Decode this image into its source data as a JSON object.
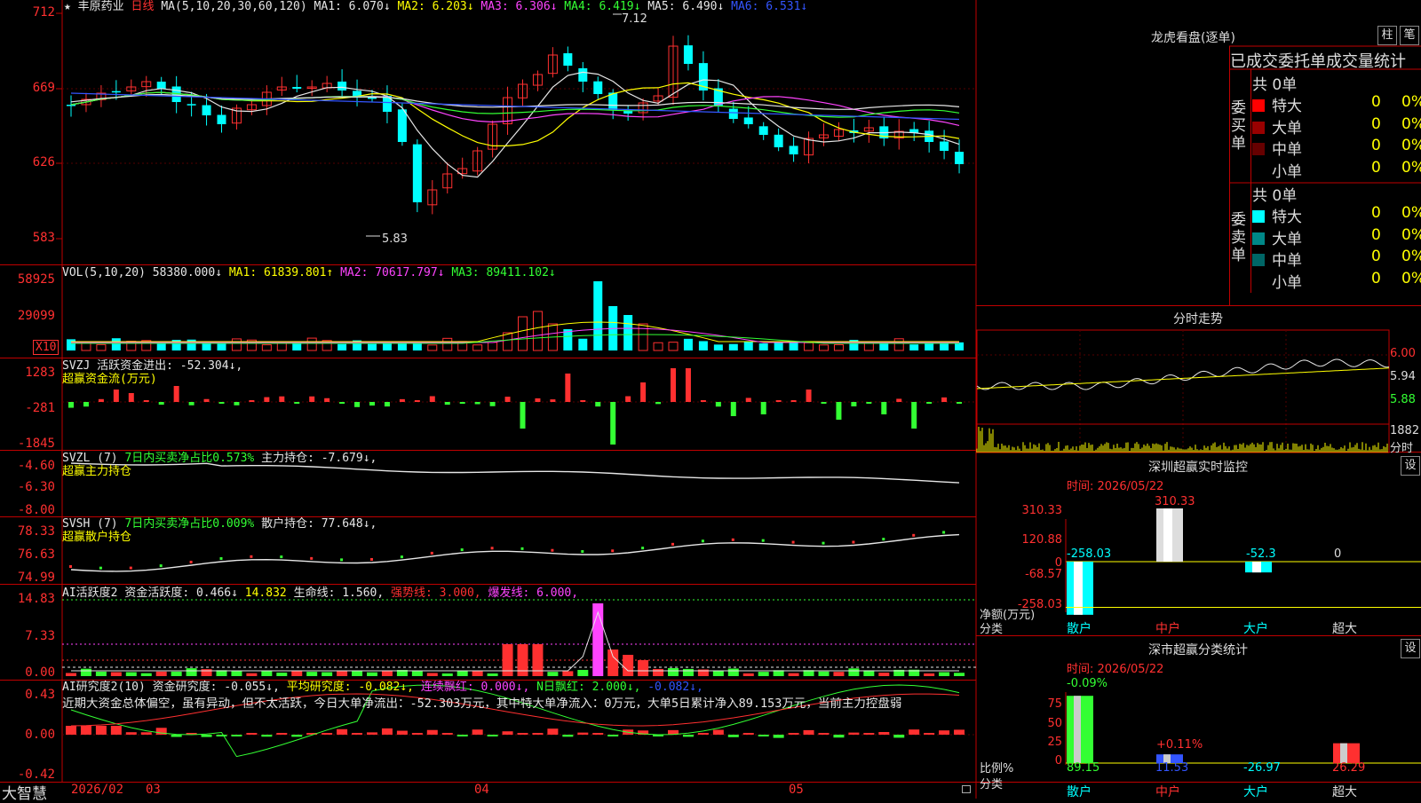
{
  "stock": {
    "star": "★",
    "name": "丰原药业",
    "period": "日线",
    "ma_label": "MA(5,10,20,30,60,120)",
    "ma": [
      {
        "label": "MA1:",
        "value": "6.070↓",
        "color": "#e6e6e6"
      },
      {
        "label": "MA2:",
        "value": "6.203↓",
        "color": "#ffff00"
      },
      {
        "label": "MA3:",
        "value": "6.306↓",
        "color": "#ff44ff"
      },
      {
        "label": "MA4:",
        "value": "6.419↓",
        "color": "#33ff33"
      },
      {
        "label": "MA5:",
        "value": "6.490↓",
        "color": "#e6e6e6"
      },
      {
        "label": "MA6:",
        "value": "6.531↓",
        "color": "#3355ff"
      }
    ],
    "high_mark": "7.12",
    "low_mark": "5.83"
  },
  "price_axis": [
    "712",
    "669",
    "626",
    "583"
  ],
  "vol": {
    "title": "VOL(5,10,20)",
    "value": "58380.000↓",
    "ma1": "MA1: 61839.801↑",
    "ma2": "MA2: 70617.797↓",
    "ma3": "MA3: 89411.102↓",
    "axis": [
      "58925",
      "29099"
    ],
    "unit": "X10"
  },
  "svzj": {
    "title": "SVZJ  活跃资金进出: -52.304↓,",
    "subtitle": "超赢资金流(万元)",
    "axis": [
      "1283",
      "-281",
      "-1845"
    ]
  },
  "svzl": {
    "title": "SVZL (7)",
    "ratio": "7日内买卖净占比0.573%",
    "hold": "主力持仓: -7.679↓,",
    "subtitle": "超赢主力持仓",
    "axis": [
      "-4.60",
      "-6.30",
      "-8.00"
    ]
  },
  "svsh": {
    "title": "SVSH (7)",
    "ratio": "7日内买卖净占比0.009%",
    "hold": "散户持仓: 77.648↓,",
    "subtitle": "超赢散户持仓",
    "axis": [
      "78.33",
      "76.63",
      "74.99"
    ]
  },
  "ai2": {
    "title": "AI活跃度2",
    "active": "资金活跃度: 0.466↓",
    "v2": "14.832",
    "life": "生命线: 1.560,",
    "strong": "强势线: 3.000,",
    "burst": "爆发线: 6.000,",
    "axis": [
      "14.83",
      "7.33",
      "0.00"
    ]
  },
  "ai_research": {
    "title": "AI研究度2(10)",
    "research": "资金研究度: -0.055↓,",
    "avg": "平均研究度: -0.082↓,",
    "red": "连续飘红: 0.000↓,",
    "n_red": "N日飘红: 2.000↓,",
    "v5": "-0.082↓,",
    "comment": "近期大资金总体偏空，虽有异动，但不太活跃，今日大单净流出：-52.303万元，其中特大单净流入：0万元，大单5日累计净入89.153万元，当前主力控盘弱",
    "axis": [
      "0.43",
      "0.00",
      "-0.42"
    ]
  },
  "footer": {
    "brand": "大智慧",
    "dates": [
      "2026/02",
      "03",
      "04",
      "05"
    ]
  },
  "right": {
    "lhb_title": "龙虎看盘(逐单)",
    "btn_zhu": "柱",
    "btn_bi": "笔",
    "tabs_label": "已成交委托单成交量统计",
    "buy": {
      "side": "委买单",
      "total": "共 0单",
      "rows": [
        {
          "name": "特大",
          "count": "0",
          "pct": "0%",
          "color": "#ff0000"
        },
        {
          "name": "大单",
          "count": "0",
          "pct": "0%",
          "color": "#990000"
        },
        {
          "name": "中单",
          "count": "0",
          "pct": "0%",
          "color": "#660000"
        },
        {
          "name": "小单",
          "count": "0",
          "pct": "0%",
          "color": "#000000"
        }
      ]
    },
    "sell": {
      "side": "委卖单",
      "total": "共 0单",
      "rows": [
        {
          "name": "特大",
          "count": "0",
          "pct": "0%",
          "color": "#00ffff"
        },
        {
          "name": "大单",
          "count": "0",
          "pct": "0%",
          "color": "#008888"
        },
        {
          "name": "中单",
          "count": "0",
          "pct": "0%",
          "color": "#006666"
        },
        {
          "name": "小单",
          "count": "0",
          "pct": "0%",
          "color": "#000000"
        }
      ]
    },
    "minute_title": "分时走势",
    "minute_axis": [
      "6.00",
      "5.94",
      "5.88"
    ],
    "minute_vol": "1882",
    "minute_vol_unit": "分时",
    "sz_title": "深圳超赢实时监控",
    "sz_btn": "设",
    "sz_time": "时间: 2026/05/22",
    "sz_axis": [
      "310.33",
      "120.88",
      "0",
      "-68.57",
      "-258.03"
    ],
    "sz_labels": [
      "-258.03",
      "310.33",
      "-52.3",
      "0"
    ],
    "sz_cats": [
      "散户",
      "中户",
      "大户",
      "超大"
    ],
    "sz_unit": "净额(万元)",
    "sz_unit2": "分类",
    "sc_title": "深市超赢分类统计",
    "sc_btn": "设",
    "sc_time": "时间: 2026/05/22",
    "sc_axis": [
      "75",
      "50",
      "25",
      "0"
    ],
    "sc_top": [
      "-0.09%",
      "+0.11%"
    ],
    "sc_vals": [
      "89.15",
      "11.53",
      "-26.97",
      "26.29"
    ],
    "sc_cats": [
      "散户",
      "中户",
      "大户",
      "超大"
    ],
    "sc_unit": "比例%",
    "sc_unit2": "分类"
  },
  "chart_data": {
    "type": "bar",
    "categories": [
      "散户",
      "中户",
      "大户",
      "超大"
    ],
    "series": [
      {
        "values": [
          -258.03,
          310.33,
          -52.3,
          0
        ]
      },
      {
        "values": [
          89.15,
          11.53,
          -26.97,
          26.29
        ]
      }
    ],
    "ylim": [
      -258.03,
      310.33
    ]
  }
}
